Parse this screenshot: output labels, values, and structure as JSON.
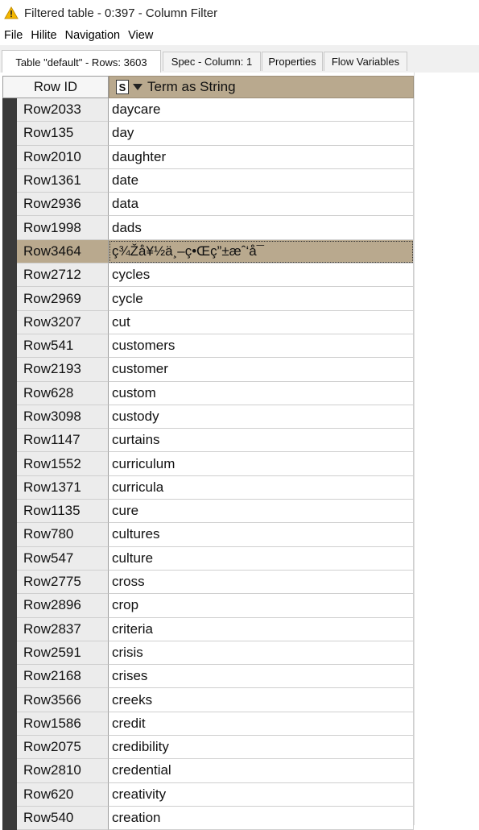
{
  "window": {
    "title": "Filtered table - 0:397 - Column Filter",
    "icon": "warning-triangle-icon"
  },
  "menu": [
    "File",
    "Hilite",
    "Navigation",
    "View"
  ],
  "tabs": [
    {
      "label": "Table \"default\" - Rows: 3603",
      "active": true
    },
    {
      "label": "Spec - Column: 1",
      "active": false
    },
    {
      "label": "Properties",
      "active": false
    },
    {
      "label": "Flow Variables",
      "active": false
    }
  ],
  "table": {
    "rowid_header": "Row ID",
    "column_header": "Term as String",
    "column_type": "S",
    "colors": {
      "header_accent": "#b9a98e",
      "selected_row": "#b9a98e",
      "row_marker": "#3a3a3a"
    },
    "rows": [
      {
        "id": "Row2033",
        "value": "daycare"
      },
      {
        "id": "Row135",
        "value": "day"
      },
      {
        "id": "Row2010",
        "value": "daughter"
      },
      {
        "id": "Row1361",
        "value": "date"
      },
      {
        "id": "Row2936",
        "value": "data"
      },
      {
        "id": "Row1998",
        "value": "dads"
      },
      {
        "id": "Row3464",
        "value": "ç¾Žå¥½ä¸–ç•Œç”±æˆ‘å¯",
        "selected": true
      },
      {
        "id": "Row2712",
        "value": "cycles"
      },
      {
        "id": "Row2969",
        "value": "cycle"
      },
      {
        "id": "Row3207",
        "value": "cut"
      },
      {
        "id": "Row541",
        "value": "customers"
      },
      {
        "id": "Row2193",
        "value": "customer"
      },
      {
        "id": "Row628",
        "value": "custom"
      },
      {
        "id": "Row3098",
        "value": "custody"
      },
      {
        "id": "Row1147",
        "value": "curtains"
      },
      {
        "id": "Row1552",
        "value": "curriculum"
      },
      {
        "id": "Row1371",
        "value": "curricula"
      },
      {
        "id": "Row1135",
        "value": "cure"
      },
      {
        "id": "Row780",
        "value": "cultures"
      },
      {
        "id": "Row547",
        "value": "culture"
      },
      {
        "id": "Row2775",
        "value": "cross"
      },
      {
        "id": "Row2896",
        "value": "crop"
      },
      {
        "id": "Row2837",
        "value": "criteria"
      },
      {
        "id": "Row2591",
        "value": "crisis"
      },
      {
        "id": "Row2168",
        "value": "crises"
      },
      {
        "id": "Row3566",
        "value": "creeks"
      },
      {
        "id": "Row1586",
        "value": "credit"
      },
      {
        "id": "Row2075",
        "value": "credibility"
      },
      {
        "id": "Row2810",
        "value": "credential"
      },
      {
        "id": "Row620",
        "value": "creativity"
      },
      {
        "id": "Row540",
        "value": "creation"
      }
    ]
  }
}
